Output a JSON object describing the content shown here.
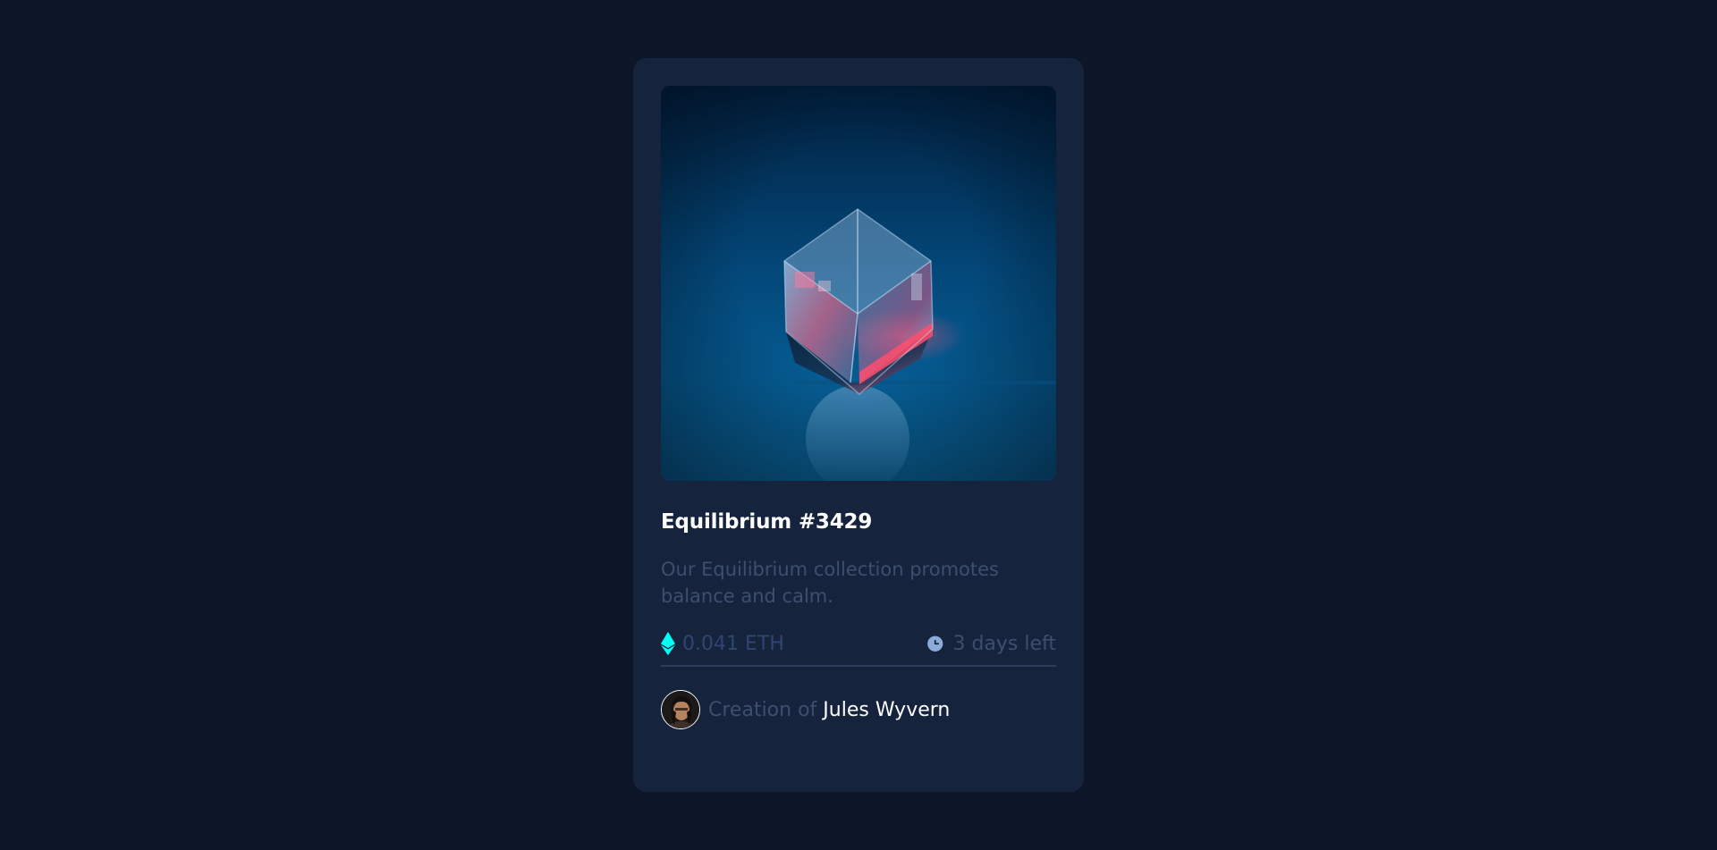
{
  "card": {
    "title": "Equilibrium #3429",
    "description": "Our Equilibrium collection promotes balance and calm.",
    "price": "0.041 ETH",
    "time_left": "3 days left",
    "creator_prefix": "Creation of",
    "creator_name": "Jules Wyvern",
    "image_alt": "Equilibrium",
    "avatar_alt": "Jules Wyvern"
  },
  "icons": {
    "price": "ethereum-icon",
    "time": "clock-icon"
  },
  "colors": {
    "page_background": "#0d1628",
    "card_background": "#15233d",
    "accent_cyan": "#00fff8",
    "muted_text": "#3d4e6e",
    "white": "#ffffff"
  }
}
